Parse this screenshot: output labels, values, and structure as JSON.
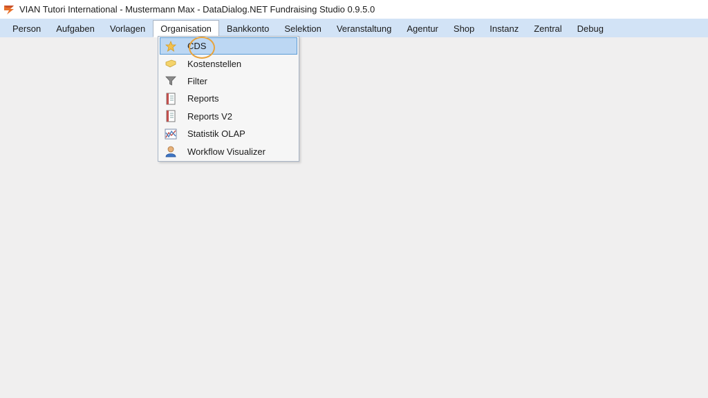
{
  "window": {
    "title": "VIAN Tutori International - Mustermann Max - DataDialog.NET Fundraising Studio 0.9.5.0",
    "icon": "app-logo-icon"
  },
  "menubar": {
    "items": [
      {
        "label": "Person"
      },
      {
        "label": "Aufgaben"
      },
      {
        "label": "Vorlagen"
      },
      {
        "label": "Organisation",
        "open": true
      },
      {
        "label": "Bankkonto"
      },
      {
        "label": "Selektion"
      },
      {
        "label": "Veranstaltung"
      },
      {
        "label": "Agentur"
      },
      {
        "label": "Shop"
      },
      {
        "label": "Instanz"
      },
      {
        "label": "Zentral"
      },
      {
        "label": "Debug"
      }
    ]
  },
  "organisation_menu": {
    "items": [
      {
        "label": "CDS",
        "icon": "star-icon",
        "selected": true
      },
      {
        "label": "Kostenstellen",
        "icon": "tag-icon"
      },
      {
        "label": "Filter",
        "icon": "funnel-icon"
      },
      {
        "label": "Reports",
        "icon": "report-icon"
      },
      {
        "label": "Reports V2",
        "icon": "report-icon"
      },
      {
        "label": "Statistik OLAP",
        "icon": "chart-icon"
      },
      {
        "label": "Workflow Visualizer",
        "icon": "user-icon"
      }
    ]
  },
  "colors": {
    "menubar_bg": "#d2e3f6",
    "selection_bg": "#bcd7f3",
    "selection_border": "#5b9bd5",
    "workspace_bg": "#f0efef",
    "cursor_ring": "#e8a33c"
  }
}
